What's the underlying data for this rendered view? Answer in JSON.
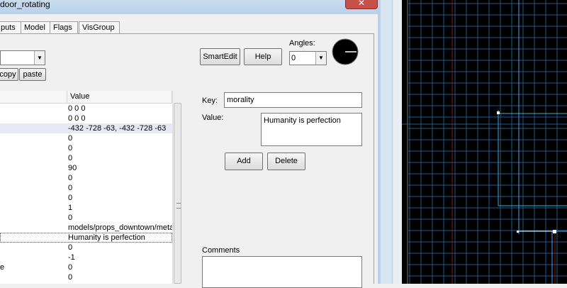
{
  "window": {
    "title": "door_rotating",
    "close_glyph": "✕"
  },
  "tabs": [
    {
      "label": "puts"
    },
    {
      "label": "Model"
    },
    {
      "label": "Flags"
    },
    {
      "label": "VisGroup"
    }
  ],
  "toolbar": {
    "copy_label": "copy",
    "paste_label": "paste",
    "smartedit_label": "SmartEdit",
    "help_label": "Help",
    "angles_label": "Angles:",
    "angles_value": "0"
  },
  "table": {
    "col_value_header": "Value",
    "rows": [
      {
        "key": "",
        "value": "0 0 0"
      },
      {
        "key": "",
        "value": "0 0 0"
      },
      {
        "key": "",
        "value": "-432 -728 -63, -432 -728 -63"
      },
      {
        "key": "",
        "value": "0"
      },
      {
        "key": "",
        "value": "0"
      },
      {
        "key": "",
        "value": "0"
      },
      {
        "key": "",
        "value": "90"
      },
      {
        "key": "",
        "value": "0"
      },
      {
        "key": "",
        "value": "0"
      },
      {
        "key": "",
        "value": "0"
      },
      {
        "key": "",
        "value": "1"
      },
      {
        "key": "",
        "value": "0"
      },
      {
        "key": "",
        "value": "models/props_downtown/meta"
      },
      {
        "key": "",
        "value": "Humanity is perfection"
      },
      {
        "key": "",
        "value": "0"
      },
      {
        "key": "",
        "value": "-1"
      },
      {
        "key": "e",
        "value": "0"
      },
      {
        "key": "",
        "value": "0"
      }
    ]
  },
  "editor": {
    "key_label": "Key:",
    "key_value": "morality",
    "value_label": "Value:",
    "value_value": "Humanity is perfection",
    "add_label": "Add",
    "delete_label": "Delete",
    "comments_label": "Comments",
    "comments_value": ""
  },
  "colors": {
    "grid_blue": "#1e5a8c",
    "grid_cyan": "#3fa7e0",
    "grid_red": "#7a1a1a",
    "selected_row": "#e8e8f5"
  }
}
